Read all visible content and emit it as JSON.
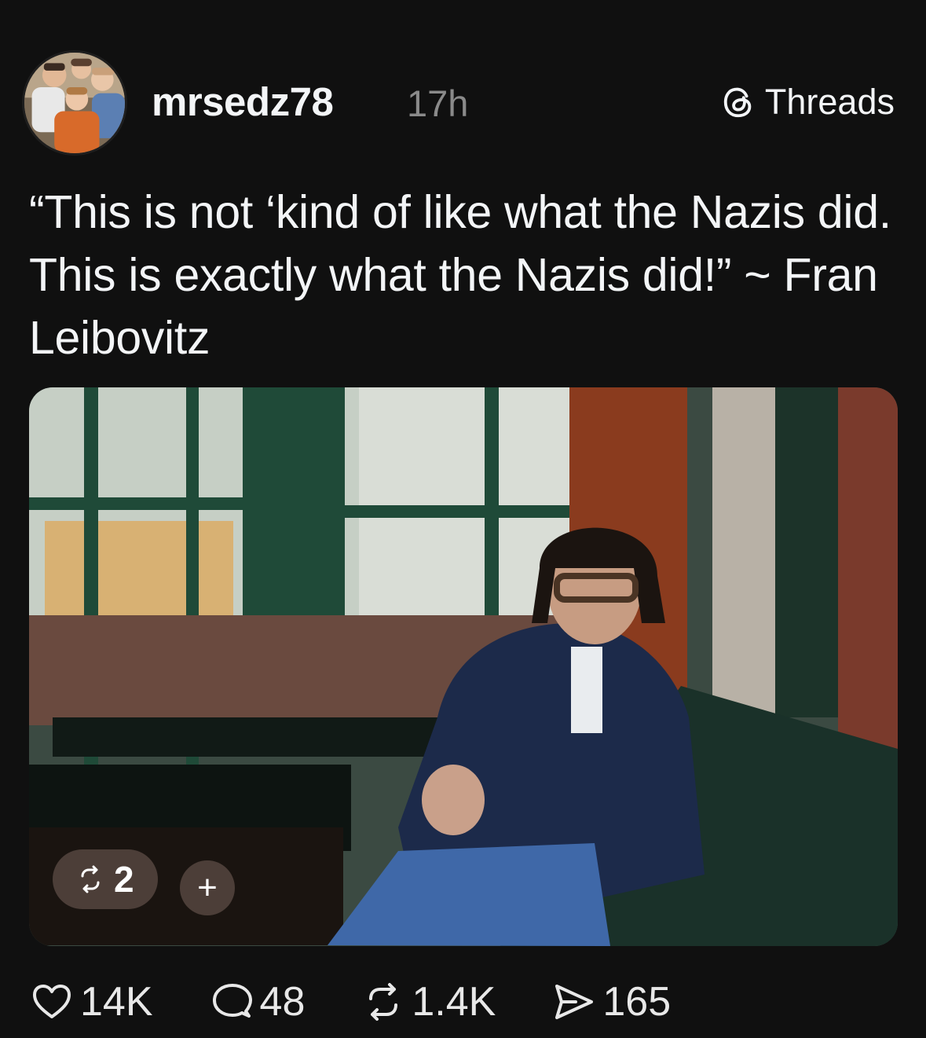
{
  "header": {
    "username": "mrsedz78",
    "timestamp": "17h",
    "brand_label": "Threads",
    "brand_icon": "threads-logo-icon",
    "avatar_icon": "profile-photo"
  },
  "post": {
    "text": "“This is not ‘kind of like what the Nazis did.  This is exactly what the Nazis did!” ~ Fran Leibovitz"
  },
  "media": {
    "description_icon": "photo",
    "repost_count": "2",
    "repost_icon": "repost-icon",
    "add_label": "+"
  },
  "actions": {
    "likes": "14K",
    "replies": "48",
    "reposts": "1.4K",
    "shares": "165",
    "like_icon": "heart-icon",
    "reply_icon": "comment-icon",
    "repost_icon": "repost-icon",
    "share_icon": "send-icon"
  }
}
